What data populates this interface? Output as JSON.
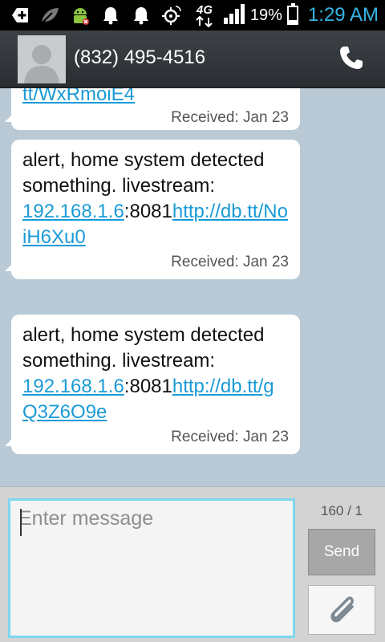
{
  "status_bar": {
    "left_icons": [
      "plus-notification-icon",
      "leaf-icon",
      "android-debug-icon",
      "notification-bell-icon",
      "notification-bell-icon",
      "gps-icon"
    ],
    "network": "4G",
    "battery_percent": "19%",
    "battery_level": 0.19,
    "time": "1:29 AM",
    "clock_color": "#33b5e5"
  },
  "header": {
    "contact": "(832) 495-4516",
    "call_icon": "phone-icon"
  },
  "messages": [
    {
      "partial": "tt/WxRmoiE4",
      "received": "Received: Jan 23"
    },
    {
      "text_before": "alert, home system detected something. livestream: ",
      "link1": "192.168.1.6",
      "text_mid": ":8081",
      "link2": "http://db.tt/NoiH6Xu0",
      "received": "Received: Jan 23"
    },
    {
      "text_before": "alert, home system detected something. livestream: ",
      "link1": "192.168.1.6",
      "text_mid": ":8081",
      "link2": "http://db.tt/gQ3Z6O9e",
      "received": "Received: Jan 23"
    }
  ],
  "compose": {
    "placeholder": "Enter message",
    "counter": "160 / 1",
    "send_label": "Send",
    "attach_icon": "paperclip-icon"
  },
  "colors": {
    "accent": "#33b5e5",
    "link": "#1a9bd6",
    "background": "#b9cad6"
  }
}
